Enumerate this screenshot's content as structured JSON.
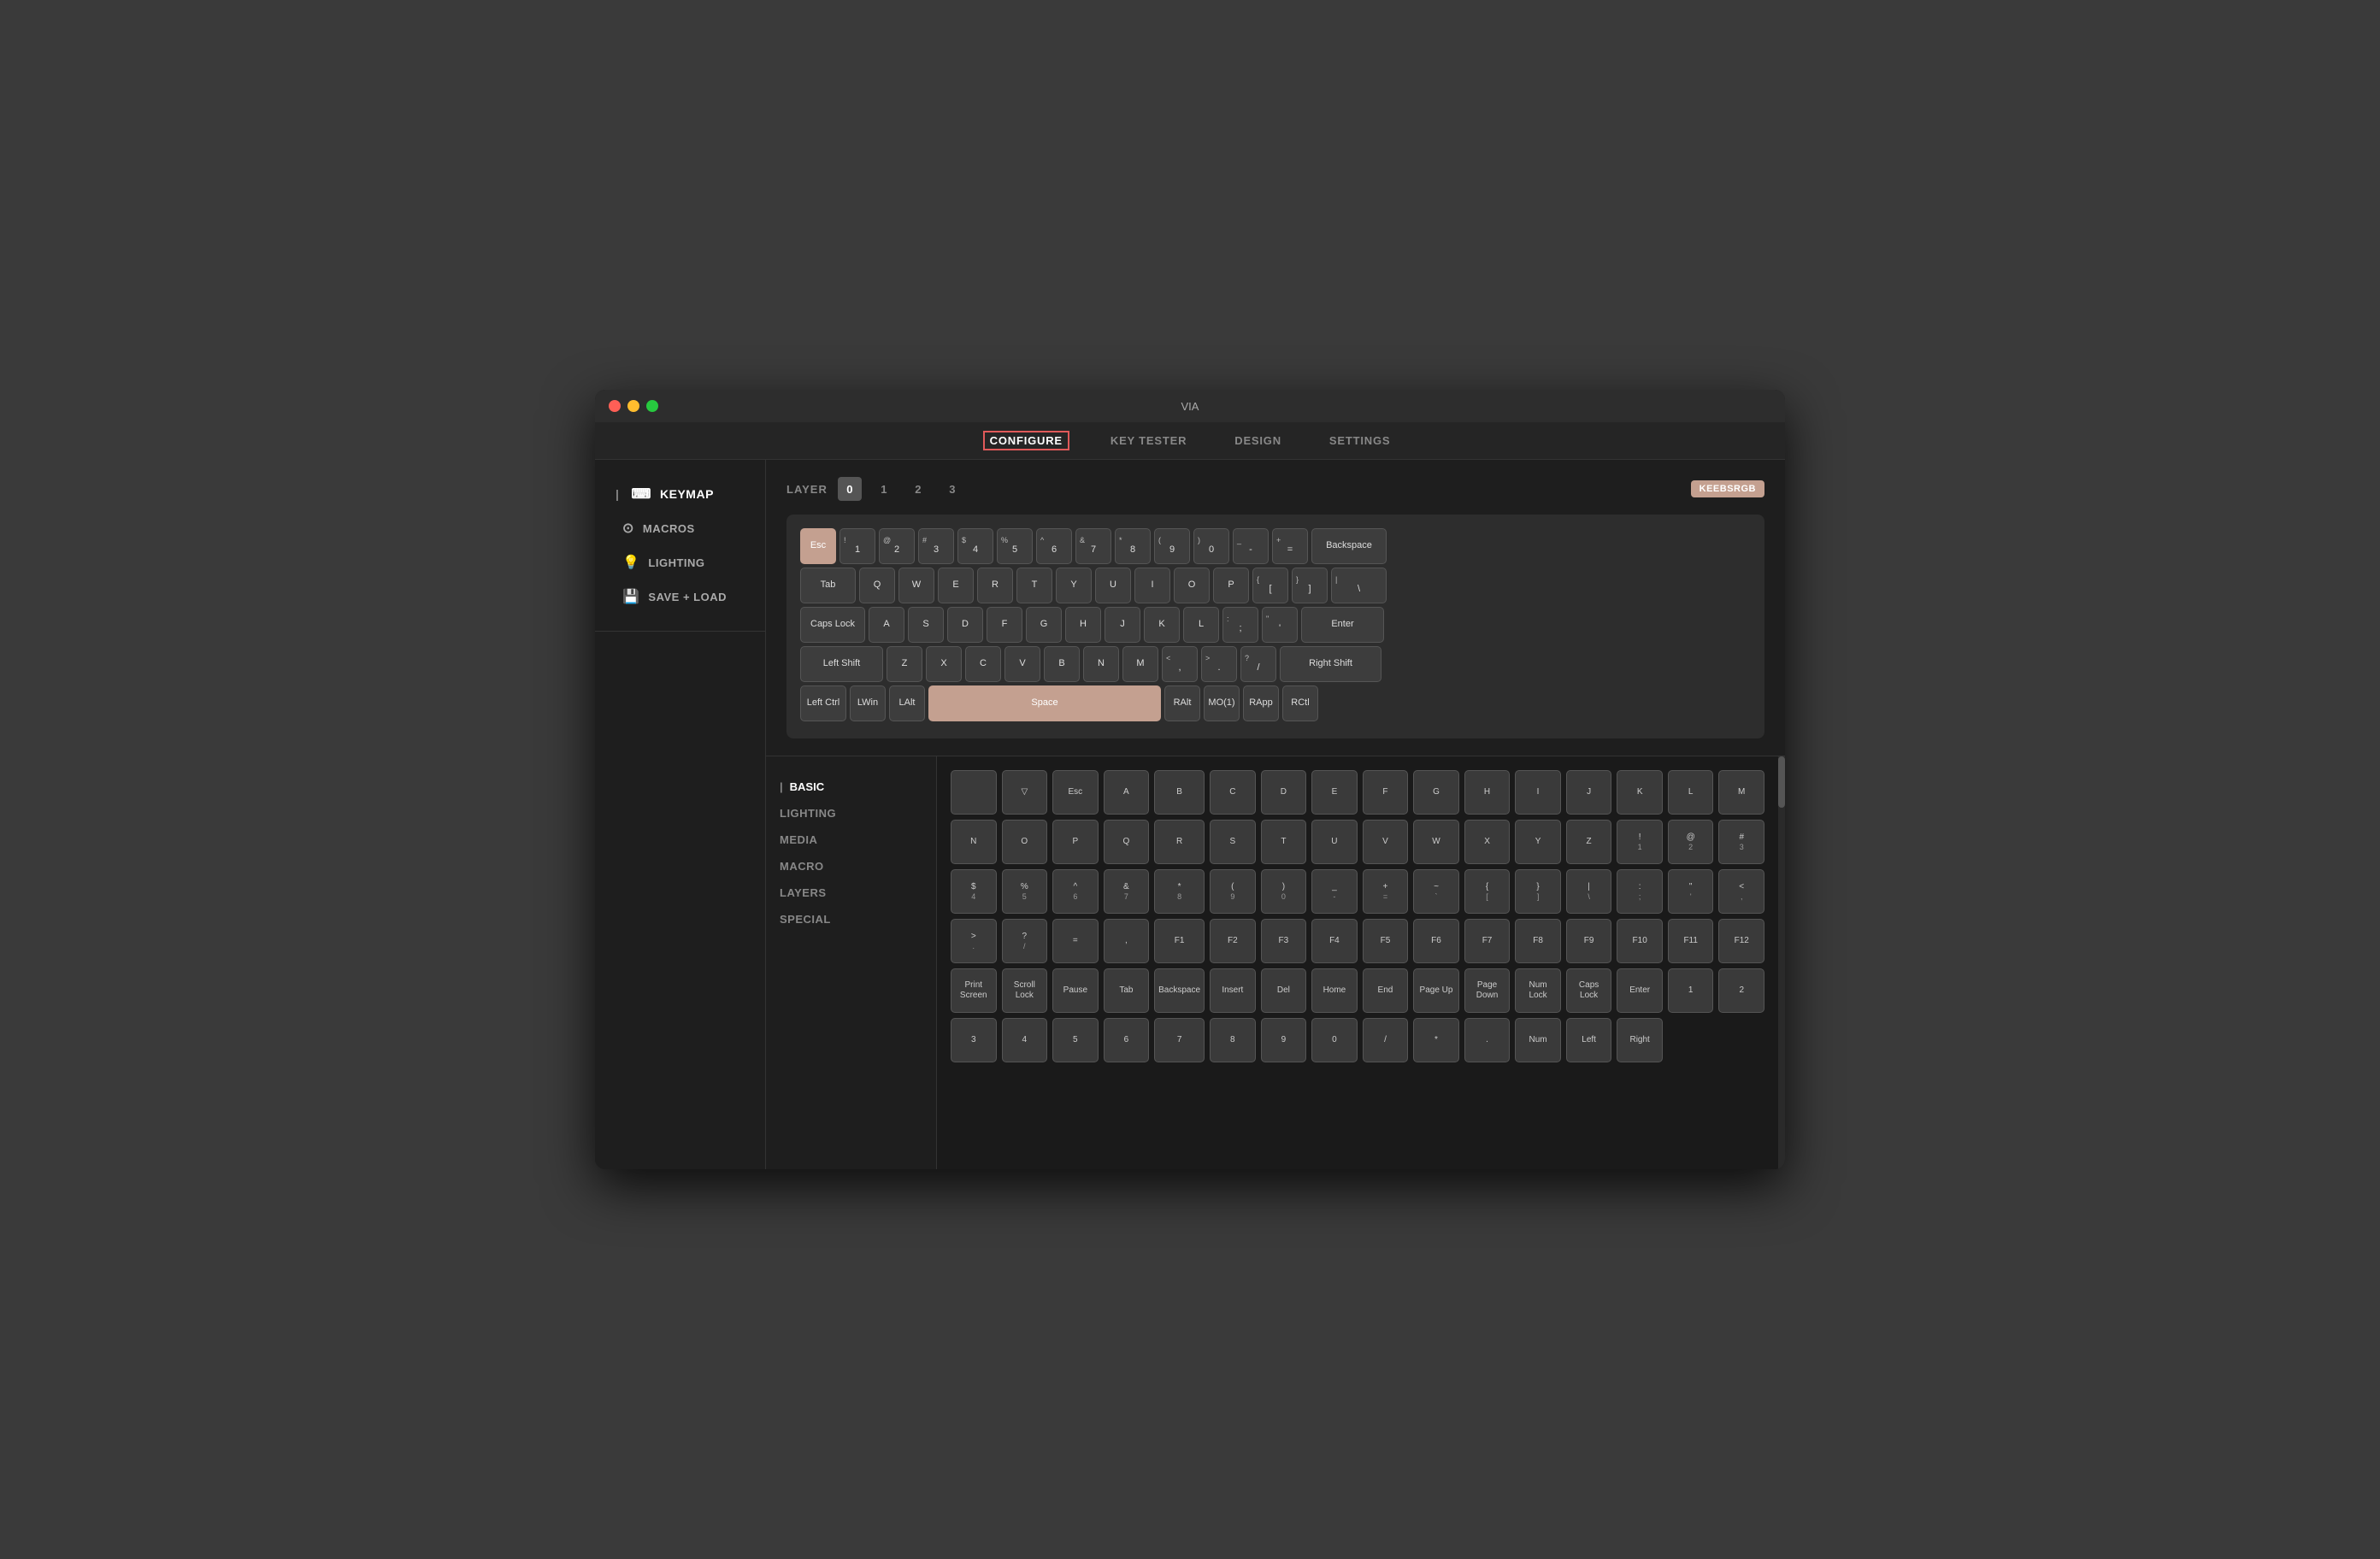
{
  "window": {
    "title": "VIA"
  },
  "nav": {
    "items": [
      {
        "id": "configure",
        "label": "CONFIGURE",
        "active": true
      },
      {
        "id": "key-tester",
        "label": "KEY TESTER",
        "active": false
      },
      {
        "id": "design",
        "label": "DESIGN",
        "active": false
      },
      {
        "id": "settings",
        "label": "SETTINGS",
        "active": false
      }
    ]
  },
  "sidebar": {
    "keymap_label": "KEYMAP",
    "macros_label": "MACROS",
    "lighting_label": "LIGHTING",
    "save_load_label": "SAVE + LOAD"
  },
  "keyboard": {
    "layer_label": "LAYER",
    "badge_label": "KEEBSRGB",
    "layers": [
      "0",
      "1",
      "2",
      "3"
    ],
    "active_layer": 0,
    "rows": [
      [
        {
          "label": "Esc",
          "top": "",
          "width": "w1",
          "highlight": true
        },
        {
          "label": "1",
          "top": "!",
          "width": "w1"
        },
        {
          "label": "2",
          "top": "@",
          "width": "w1"
        },
        {
          "label": "3",
          "top": "#",
          "width": "w1"
        },
        {
          "label": "4",
          "top": "$",
          "width": "w1"
        },
        {
          "label": "5",
          "top": "%",
          "width": "w1"
        },
        {
          "label": "6",
          "top": "^",
          "width": "w1"
        },
        {
          "label": "7",
          "top": "&",
          "width": "w1"
        },
        {
          "label": "8",
          "top": "*",
          "width": "w1"
        },
        {
          "label": "9",
          "top": "(",
          "width": "w1"
        },
        {
          "label": "0",
          "top": ")",
          "width": "w1"
        },
        {
          "label": "-",
          "top": "_",
          "width": "w1"
        },
        {
          "label": "=",
          "top": "+",
          "width": "w1"
        },
        {
          "label": "Backspace",
          "top": "",
          "width": "w2"
        }
      ],
      [
        {
          "label": "Tab",
          "top": "",
          "width": "w15"
        },
        {
          "label": "Q",
          "top": "",
          "width": "w1"
        },
        {
          "label": "W",
          "top": "",
          "width": "w1"
        },
        {
          "label": "E",
          "top": "",
          "width": "w1"
        },
        {
          "label": "R",
          "top": "",
          "width": "w1"
        },
        {
          "label": "T",
          "top": "",
          "width": "w1"
        },
        {
          "label": "Y",
          "top": "",
          "width": "w1"
        },
        {
          "label": "U",
          "top": "",
          "width": "w1"
        },
        {
          "label": "I",
          "top": "",
          "width": "w1"
        },
        {
          "label": "O",
          "top": "",
          "width": "w1"
        },
        {
          "label": "P",
          "top": "",
          "width": "w1"
        },
        {
          "label": "[",
          "top": "{",
          "width": "w1"
        },
        {
          "label": "]",
          "top": "}",
          "width": "w1"
        },
        {
          "label": "\\",
          "top": "|",
          "width": "w15"
        }
      ],
      [
        {
          "label": "Caps Lock",
          "top": "",
          "width": "w175"
        },
        {
          "label": "A",
          "top": "",
          "width": "w1"
        },
        {
          "label": "S",
          "top": "",
          "width": "w1"
        },
        {
          "label": "D",
          "top": "",
          "width": "w1"
        },
        {
          "label": "F",
          "top": "",
          "width": "w1"
        },
        {
          "label": "G",
          "top": "",
          "width": "w1"
        },
        {
          "label": "H",
          "top": "",
          "width": "w1"
        },
        {
          "label": "J",
          "top": "",
          "width": "w1"
        },
        {
          "label": "K",
          "top": "",
          "width": "w1"
        },
        {
          "label": "L",
          "top": "",
          "width": "w1"
        },
        {
          "label": ";",
          "top": ":",
          "width": "w1"
        },
        {
          "label": "'",
          "top": "\"",
          "width": "w1"
        },
        {
          "label": "Enter",
          "top": "",
          "width": "w225"
        }
      ],
      [
        {
          "label": "Left Shift",
          "top": "",
          "width": "w225"
        },
        {
          "label": "Z",
          "top": "",
          "width": "w1"
        },
        {
          "label": "X",
          "top": "",
          "width": "w1"
        },
        {
          "label": "C",
          "top": "",
          "width": "w1"
        },
        {
          "label": "V",
          "top": "",
          "width": "w1"
        },
        {
          "label": "B",
          "top": "",
          "width": "w1"
        },
        {
          "label": "N",
          "top": "",
          "width": "w1"
        },
        {
          "label": "M",
          "top": "",
          "width": "w1"
        },
        {
          "label": ",",
          "top": "<",
          "width": "w1"
        },
        {
          "label": ".",
          "top": ">",
          "width": "w1"
        },
        {
          "label": "/",
          "top": "?",
          "width": "w1"
        },
        {
          "label": "Right Shift",
          "top": "",
          "width": "w275"
        }
      ],
      [
        {
          "label": "Left Ctrl",
          "top": "",
          "width": "w125"
        },
        {
          "label": "LWin",
          "top": "",
          "width": "w1"
        },
        {
          "label": "LAlt",
          "top": "",
          "width": "w1"
        },
        {
          "label": "Space",
          "top": "",
          "width": "w625",
          "highlight": true
        },
        {
          "label": "RAlt",
          "top": "",
          "width": "w1"
        },
        {
          "label": "MO(1)",
          "top": "",
          "width": "w1"
        },
        {
          "label": "RApp",
          "top": "",
          "width": "w1"
        },
        {
          "label": "RCtl",
          "top": "",
          "width": "w1"
        }
      ]
    ]
  },
  "key_picker": {
    "sections": [
      {
        "id": "basic",
        "label": "BASIC",
        "active": true
      },
      {
        "id": "lighting",
        "label": "LIGHTING"
      },
      {
        "id": "media",
        "label": "MEDIA"
      },
      {
        "id": "macro",
        "label": "MACRO"
      },
      {
        "id": "layers",
        "label": "LAYERS"
      },
      {
        "id": "special",
        "label": "SPECIAL"
      }
    ],
    "grid_keys": [
      {
        "label": "",
        "sub": ""
      },
      {
        "label": "▽",
        "sub": ""
      },
      {
        "label": "Esc",
        "sub": ""
      },
      {
        "label": "A",
        "sub": ""
      },
      {
        "label": "B",
        "sub": ""
      },
      {
        "label": "C",
        "sub": ""
      },
      {
        "label": "D",
        "sub": ""
      },
      {
        "label": "E",
        "sub": ""
      },
      {
        "label": "F",
        "sub": ""
      },
      {
        "label": "G",
        "sub": ""
      },
      {
        "label": "H",
        "sub": ""
      },
      {
        "label": "I",
        "sub": ""
      },
      {
        "label": "J",
        "sub": ""
      },
      {
        "label": "K",
        "sub": ""
      },
      {
        "label": "L",
        "sub": ""
      },
      {
        "label": "M",
        "sub": ""
      },
      {
        "label": "N",
        "sub": ""
      },
      {
        "label": "O",
        "sub": ""
      },
      {
        "label": "P",
        "sub": ""
      },
      {
        "label": "Q",
        "sub": ""
      },
      {
        "label": "R",
        "sub": ""
      },
      {
        "label": "S",
        "sub": ""
      },
      {
        "label": "T",
        "sub": ""
      },
      {
        "label": "U",
        "sub": ""
      },
      {
        "label": "V",
        "sub": ""
      },
      {
        "label": "W",
        "sub": ""
      },
      {
        "label": "X",
        "sub": ""
      },
      {
        "label": "Y",
        "sub": ""
      },
      {
        "label": "Z",
        "sub": ""
      },
      {
        "label": "!",
        "sub": "1"
      },
      {
        "label": "@",
        "sub": "2"
      },
      {
        "label": "#",
        "sub": "3"
      },
      {
        "label": "$",
        "sub": "4"
      },
      {
        "label": "%",
        "sub": "5"
      },
      {
        "label": "^",
        "sub": "6"
      },
      {
        "label": "&",
        "sub": "7"
      },
      {
        "label": "*",
        "sub": "8"
      },
      {
        "label": "(",
        "sub": "9"
      },
      {
        "label": ")",
        "sub": "0"
      },
      {
        "label": "_",
        "sub": "-"
      },
      {
        "label": "+",
        "sub": "="
      },
      {
        "label": "~",
        "sub": "`"
      },
      {
        "label": "{",
        "sub": "["
      },
      {
        "label": "}",
        "sub": "]"
      },
      {
        "label": "|",
        "sub": "\\"
      },
      {
        "label": ":",
        "sub": ";"
      },
      {
        "label": "\"",
        "sub": "'"
      },
      {
        "label": "<",
        "sub": ","
      },
      {
        "label": ">",
        "sub": "."
      },
      {
        "label": "?",
        "sub": "/"
      },
      {
        "label": "=",
        "sub": ""
      },
      {
        "label": ",",
        "sub": ""
      },
      {
        "label": "F1",
        "sub": ""
      },
      {
        "label": "F2",
        "sub": ""
      },
      {
        "label": "F3",
        "sub": ""
      },
      {
        "label": "F4",
        "sub": ""
      },
      {
        "label": "F5",
        "sub": ""
      },
      {
        "label": "F6",
        "sub": ""
      },
      {
        "label": "F7",
        "sub": ""
      },
      {
        "label": "F8",
        "sub": ""
      },
      {
        "label": "F9",
        "sub": ""
      },
      {
        "label": "F10",
        "sub": ""
      },
      {
        "label": "F11",
        "sub": ""
      },
      {
        "label": "F12",
        "sub": ""
      },
      {
        "label": "Print\nScreen",
        "sub": ""
      },
      {
        "label": "Scroll\nLock",
        "sub": ""
      },
      {
        "label": "Pause",
        "sub": ""
      },
      {
        "label": "Tab",
        "sub": ""
      },
      {
        "label": "Backspace",
        "sub": ""
      },
      {
        "label": "Insert",
        "sub": ""
      },
      {
        "label": "Del",
        "sub": ""
      },
      {
        "label": "Home",
        "sub": ""
      },
      {
        "label": "End",
        "sub": ""
      },
      {
        "label": "Page Up",
        "sub": ""
      },
      {
        "label": "Page\nDown",
        "sub": ""
      },
      {
        "label": "Num\nLock",
        "sub": ""
      },
      {
        "label": "Caps\nLock",
        "sub": ""
      },
      {
        "label": "Enter",
        "sub": ""
      },
      {
        "label": "1",
        "sub": ""
      },
      {
        "label": "2",
        "sub": ""
      },
      {
        "label": "3",
        "sub": ""
      },
      {
        "label": "4",
        "sub": ""
      },
      {
        "label": "5",
        "sub": ""
      },
      {
        "label": "6",
        "sub": ""
      },
      {
        "label": "7",
        "sub": ""
      },
      {
        "label": "8",
        "sub": ""
      },
      {
        "label": "9",
        "sub": ""
      },
      {
        "label": "0",
        "sub": ""
      },
      {
        "label": "/",
        "sub": ""
      },
      {
        "label": "*",
        "sub": ""
      },
      {
        "label": ".",
        "sub": ""
      },
      {
        "label": "Num",
        "sub": ""
      },
      {
        "label": "Left",
        "sub": ""
      },
      {
        "label": "Right",
        "sub": ""
      }
    ]
  }
}
